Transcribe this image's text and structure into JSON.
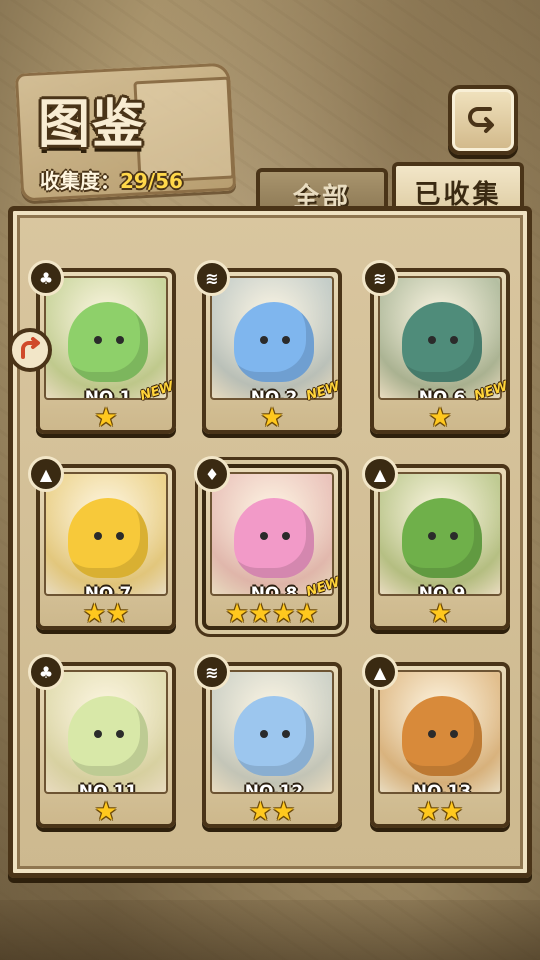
{
  "header": {
    "title": "图鉴",
    "collection_label": "收集度：",
    "collection_value": "29/56",
    "back_icon": "return-arrow-icon"
  },
  "tabs": [
    {
      "label": "全部",
      "active": false
    },
    {
      "label": "已收集",
      "active": true
    }
  ],
  "cards": [
    {
      "number": "NO.1",
      "element": "grass-icon",
      "stars": "★",
      "new": "NEW",
      "color": "#8ed06a"
    },
    {
      "number": "NO.2",
      "element": "water-icon",
      "stars": "★",
      "new": "NEW",
      "color": "#7fb6ee"
    },
    {
      "number": "NO.6",
      "element": "water-icon",
      "stars": "★",
      "new": "NEW",
      "color": "#4f8c7a"
    },
    {
      "number": "NO.7",
      "element": "earth-icon",
      "stars": "★★",
      "new": "",
      "color": "#f7c93a"
    },
    {
      "number": "NO.8",
      "element": "fire-icon",
      "stars": "★★★★",
      "new": "NEW",
      "color": "#f29ac8"
    },
    {
      "number": "NO.9",
      "element": "earth-icon",
      "stars": "★",
      "new": "",
      "color": "#6fb04a"
    },
    {
      "number": "NO.11",
      "element": "grass-icon",
      "stars": "★",
      "new": "",
      "color": "#d8e8a8"
    },
    {
      "number": "NO.12",
      "element": "water-icon",
      "stars": "★★",
      "new": "",
      "color": "#9cc6ee"
    },
    {
      "number": "NO.13",
      "element": "earth-icon",
      "stars": "★★",
      "new": "",
      "color": "#d88a3a"
    }
  ]
}
